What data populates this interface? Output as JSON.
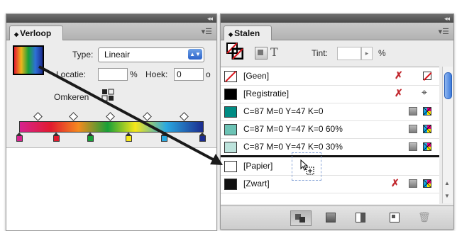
{
  "verloop": {
    "tab_label": "Verloop",
    "type_label": "Type:",
    "type_value": "Lineair",
    "locatie_label": "Locatie:",
    "locatie_value": "",
    "percent_sign": "%",
    "hoek_label": "Hoek:",
    "hoek_value": "0",
    "degree_sign": "o",
    "omkeren_label": "Omkeren",
    "stop_colors": [
      "#d6238f",
      "#e11b2e",
      "#18a038",
      "#f6e71a",
      "#2aa8e0",
      "#1b2c8f"
    ]
  },
  "stalen": {
    "tab_label": "Stalen",
    "tint_label": "Tint:",
    "tint_value": "",
    "tint_percent": "%",
    "swatches": [
      {
        "name": "[Geen]",
        "color": "none"
      },
      {
        "name": "[Registratie]",
        "color": "#000000"
      },
      {
        "name": "C=87 M=0 Y=47 K=0",
        "color": "#008c84"
      },
      {
        "name": "C=87 M=0 Y=47 K=0 60%",
        "color": "#6cc3b5"
      },
      {
        "name": "C=87 M=0 Y=47 K=0 30%",
        "color": "#bde3dc"
      },
      {
        "name": "[Papier]",
        "color": "#ffffff"
      },
      {
        "name": "[Zwart]",
        "color": "#111111"
      }
    ]
  }
}
